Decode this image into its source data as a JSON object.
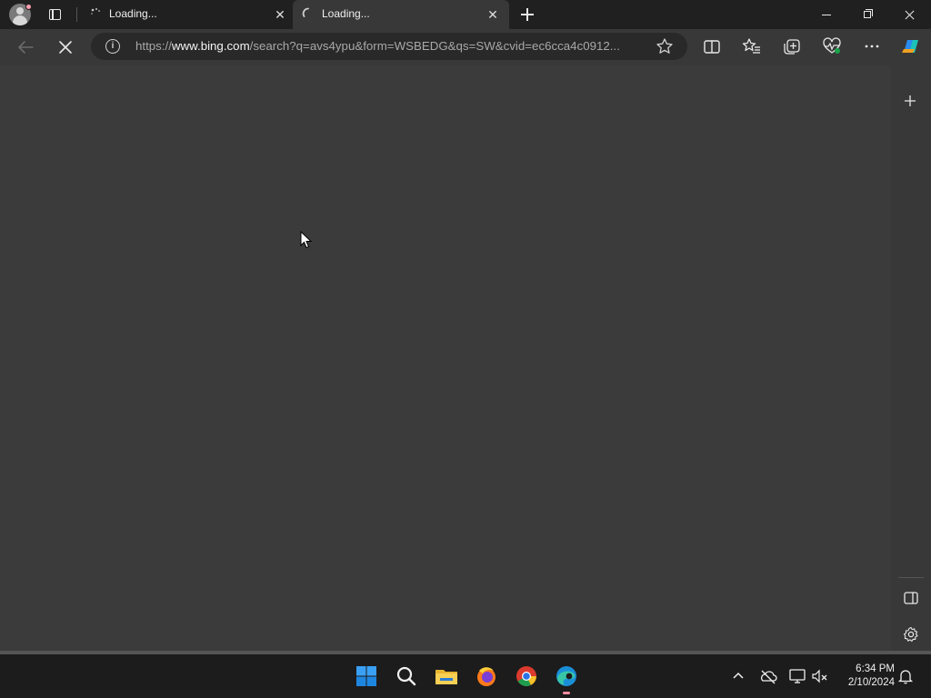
{
  "browser": {
    "tabs": [
      {
        "title": "Loading...",
        "active": false
      },
      {
        "title": "Loading...",
        "active": true
      }
    ],
    "address": {
      "scheme": "https://",
      "host": "www.bing.com",
      "path": "/search?q=avs4ypu&form=WSBEDG&qs=SW&cvid=ec6cca4c0912..."
    }
  },
  "taskbar": {
    "apps": [
      "start",
      "search",
      "file-explorer",
      "firefox",
      "chrome",
      "edge"
    ],
    "time": "6:34 PM",
    "date": "2/10/2024"
  },
  "colors": {
    "page_bg": "#3b3b3b",
    "chrome_bg": "#383838",
    "tabstrip_bg": "#202020",
    "taskbar_bg": "#1c1c1c",
    "accent": "#0078d4"
  }
}
